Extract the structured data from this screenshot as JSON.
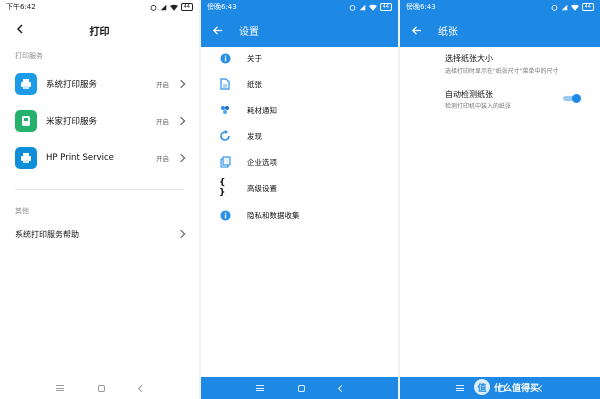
{
  "panel1": {
    "status": {
      "time": "下午6:42",
      "battery": "44"
    },
    "title": "打印",
    "section_print_services": "打印服务",
    "services": [
      {
        "name": "系统打印服务",
        "state": "开启",
        "icon": "system-print-icon",
        "color": "#1e9be6"
      },
      {
        "name": "米家打印服务",
        "state": "开启",
        "icon": "mijia-print-icon",
        "color": "#26b16d"
      },
      {
        "name": "HP Print Service",
        "state": "开启",
        "icon": "hp-print-icon",
        "color": "#0d8ed9"
      }
    ],
    "section_other": "其他",
    "help_item": "系统打印服务帮助"
  },
  "panel2": {
    "status": {
      "time": "傍晚6:43",
      "battery": "44"
    },
    "title": "设置",
    "items": [
      {
        "label": "关于",
        "icon": "info-icon"
      },
      {
        "label": "纸张",
        "icon": "paper-icon"
      },
      {
        "label": "耗材通知",
        "icon": "supplies-icon"
      },
      {
        "label": "发现",
        "icon": "discover-icon"
      },
      {
        "label": "企业选项",
        "icon": "enterprise-icon"
      },
      {
        "label": "高级设置",
        "icon": "braces-icon"
      },
      {
        "label": "隐私和数据收集",
        "icon": "info-icon"
      }
    ]
  },
  "panel3": {
    "status": {
      "time": "傍晚6:43",
      "battery": "44"
    },
    "title": "纸张",
    "paper_size_title": "选择纸张大小",
    "paper_size_desc": "选择打印时显示在\"纸张尺寸\"菜单中的尺寸",
    "auto_detect_title": "自动检测纸张",
    "auto_detect_desc": "检测打印机中装入的纸张",
    "auto_detect_enabled": true,
    "accent": "#1e88e5"
  },
  "watermark": {
    "glyph": "值",
    "text": "什么值得买"
  }
}
